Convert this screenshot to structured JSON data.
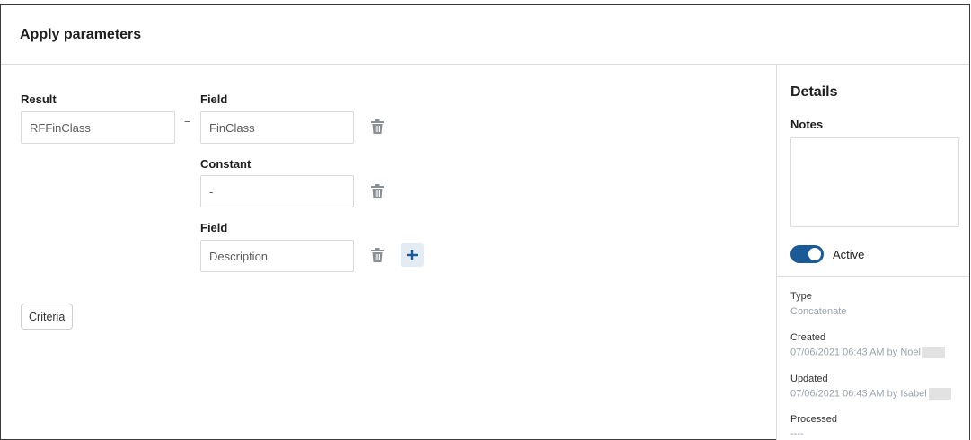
{
  "header": {
    "title": "Apply parameters"
  },
  "result": {
    "label": "Result",
    "value": "RFFinClass"
  },
  "equals": "=",
  "params": [
    {
      "label": "Field",
      "value": "FinClass"
    },
    {
      "label": "Constant",
      "value": "-"
    },
    {
      "label": "Field",
      "value": "Description"
    }
  ],
  "criteria_label": "Criteria",
  "details": {
    "title": "Details",
    "notes_label": "Notes",
    "notes_value": "",
    "active_label": "Active",
    "active": true,
    "type_label": "Type",
    "type_value": "Concatenate",
    "created_label": "Created",
    "created_value": "07/06/2021 06:43 AM by Noel",
    "updated_label": "Updated",
    "updated_value": "07/06/2021 06:43 AM by Isabel",
    "processed_label": "Processed",
    "processed_value": "----"
  },
  "colors": {
    "accent": "#1a5a96",
    "add_bg": "#e3ecf5",
    "muted_text": "#9aa3ad"
  }
}
